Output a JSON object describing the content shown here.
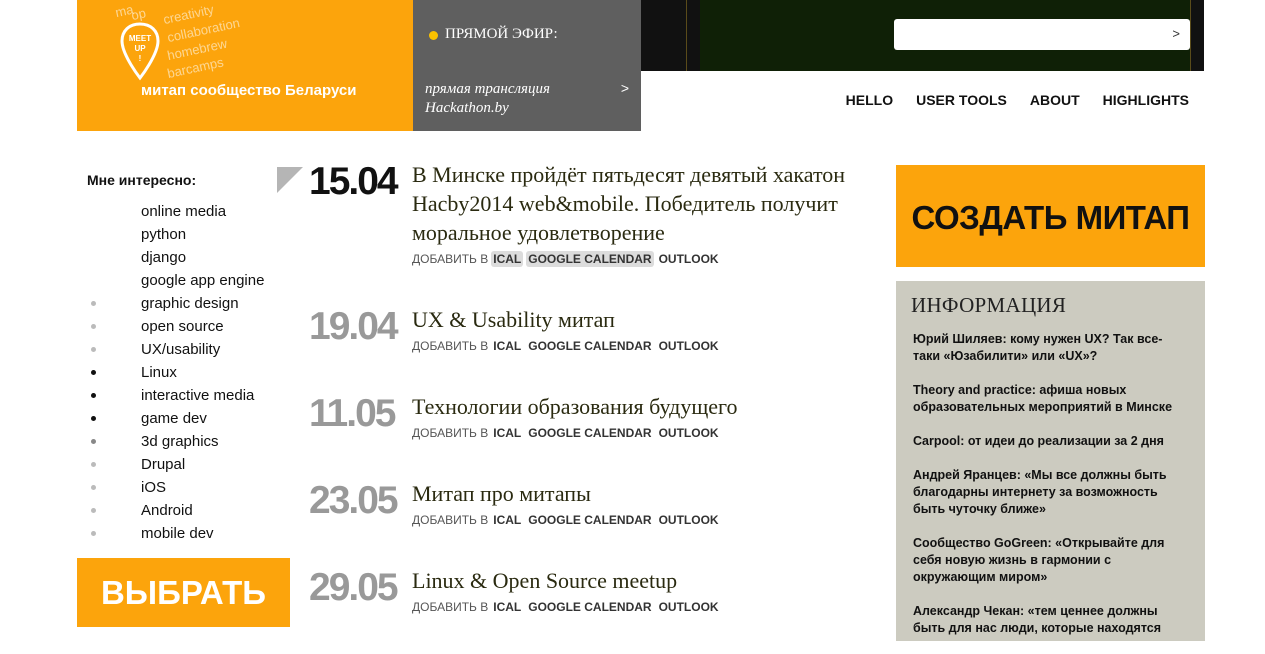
{
  "logo": {
    "tags": [
      "creativity",
      "collaboration",
      "homebrew",
      "barcamps",
      "ma",
      "op"
    ],
    "pin_text": "MEET UP !",
    "name": "митап сообщество Беларуси"
  },
  "live": {
    "label": "ПРЯМОЙ ЭФИР:",
    "description": "прямая трансляция Hackathon.by",
    "arrow": ">"
  },
  "search": {
    "placeholder": "",
    "go": ">"
  },
  "nav": [
    "HELLO",
    "USER TOOLS",
    "ABOUT",
    "HIGHLIGHTS"
  ],
  "sidebar": {
    "title": "Мне интересно:",
    "interests": [
      {
        "label": "online media",
        "bullet": ""
      },
      {
        "label": "python",
        "bullet": ""
      },
      {
        "label": "django",
        "bullet": ""
      },
      {
        "label": "google app engine",
        "bullet": ""
      },
      {
        "label": "graphic design",
        "bullet": "#bbbbbb"
      },
      {
        "label": "open source",
        "bullet": "#bbbbbb"
      },
      {
        "label": "UX/usability",
        "bullet": "#bbbbbb"
      },
      {
        "label": "Linux",
        "bullet": "#111111"
      },
      {
        "label": "interactive media",
        "bullet": "#111111"
      },
      {
        "label": "game dev",
        "bullet": "#111111"
      },
      {
        "label": "3d graphics",
        "bullet": "#888888"
      },
      {
        "label": "Drupal",
        "bullet": "#bbbbbb"
      },
      {
        "label": "iOS",
        "bullet": "#bbbbbb"
      },
      {
        "label": "Android",
        "bullet": "#bbbbbb"
      },
      {
        "label": "mobile dev",
        "bullet": "#bbbbbb"
      }
    ],
    "choose_button": "ВЫБРАТЬ"
  },
  "events": [
    {
      "date": "15.04",
      "title": "В Минске пройдёт пятьдесят девятый хакатон Hacby2014 web&mobile. Победитель получит моральное удовлетворение",
      "add_label": "ДОБАВИТЬ В",
      "ical": "ICAL",
      "gcal": "GOOGLE CALENDAR",
      "outlook": "OUTLOOK"
    },
    {
      "date": "19.04",
      "title": "UX & Usability митап",
      "add_label": "ДОБАВИТЬ В",
      "ical": "ICAL",
      "gcal": "GOOGLE CALENDAR",
      "outlook": "OUTLOOK"
    },
    {
      "date": "11.05",
      "title": "Технологии образования будущего",
      "add_label": "ДОБАВИТЬ В",
      "ical": "ICAL",
      "gcal": "GOOGLE CALENDAR",
      "outlook": "OUTLOOK"
    },
    {
      "date": "23.05",
      "title": "Митап про митапы",
      "add_label": "ДОБАВИТЬ В",
      "ical": "ICAL",
      "gcal": "GOOGLE CALENDAR",
      "outlook": "OUTLOOK"
    },
    {
      "date": "29.05",
      "title": "Linux & Open Source meetup",
      "add_label": "ДОБАВИТЬ В",
      "ical": "ICAL",
      "gcal": "GOOGLE CALENDAR",
      "outlook": "OUTLOOK"
    }
  ],
  "create_button": "СОЗДАТЬ МИТАП",
  "info": {
    "title": "ИНФОРМАЦИЯ",
    "items": [
      "Юрий Шиляев: кому нужен UX? Так все-таки «Юзабилити» или «UX»?",
      "Theory and practice: афиша новых образовательных мероприятий в Минске",
      "Carpool: от идеи до реализации за 2 дня",
      "Андрей Яранцев: «Мы все должны быть благодарны интернету за возможность быть чуточку ближе»",
      "Сообщество GoGreen: «Открывайте для себя новую жизнь в гармонии с окружающим миром»",
      "Александр Чекан: «тем ценнее должны быть для нас люди, которые находятся"
    ]
  },
  "colors": {
    "accent": "#fca40c",
    "live_bg": "#5f5f5f",
    "info_bg": "#cccbc0"
  }
}
